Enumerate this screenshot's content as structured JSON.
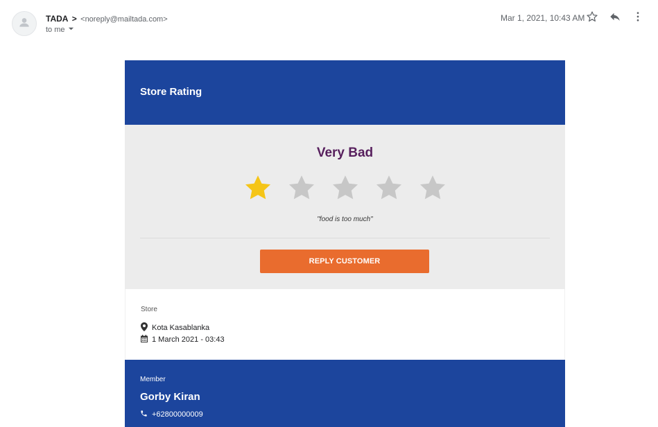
{
  "header": {
    "sender_name": "TADA",
    "sender_arrow": ">",
    "sender_email": "<noreply@mailtada.com>",
    "recipient": "to me",
    "date": "Mar 1, 2021, 10:43 AM",
    "icons": {
      "avatar": "person-icon",
      "recipient_dropdown": "caret-down-icon",
      "star": "star-outline-icon",
      "reply": "reply-icon",
      "more": "more-vertical-icon"
    }
  },
  "email": {
    "title": "Store Rating",
    "rating": {
      "label": "Very Bad",
      "value": 1,
      "max": 5,
      "filled_color": "#f5c518",
      "empty_color": "#c7c7c7",
      "comment": "\"food is too much\""
    },
    "reply_button": "REPLY CUSTOMER",
    "store": {
      "section_label": "Store",
      "name": "Kota Kasablanka",
      "datetime": "1 March 2021 - 03:43",
      "icons": [
        "map-marker-icon",
        "calendar-icon"
      ]
    },
    "member": {
      "section_label": "Member",
      "name": "Gorby Kiran",
      "phone": "+62800000009",
      "icon": "phone-icon"
    },
    "colors": {
      "brand_blue": "#1c459d",
      "rating_purple": "#571f5d",
      "button_orange": "#e96c2e",
      "panel_gray": "#ececec"
    }
  }
}
